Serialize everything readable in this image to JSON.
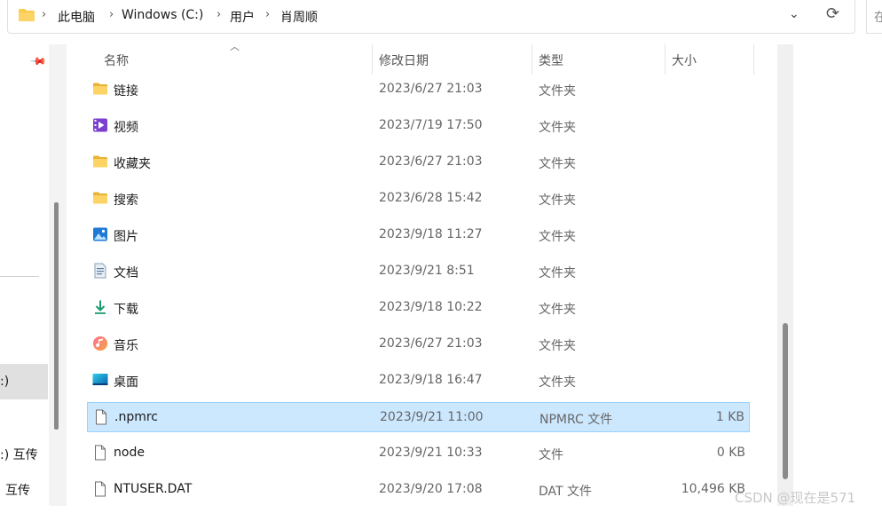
{
  "address_bar": {
    "crumbs": [
      "此电脑",
      "Windows (C:)",
      "用户",
      "肖周顺"
    ],
    "separator": "›",
    "dropdown_glyph": "⌄",
    "refresh_glyph": "⟳"
  },
  "search": {
    "text": "在"
  },
  "nav_pane": {
    "items": [
      ":)",
      ":) 互传",
      "互传"
    ]
  },
  "columns": {
    "name": "名称",
    "modified": "修改日期",
    "type": "类型",
    "size": "大小"
  },
  "files": [
    {
      "name": "链接",
      "modified": "2023/6/27 21:03",
      "type": "文件夹",
      "size": "",
      "icon": "folder-icon"
    },
    {
      "name": "视频",
      "modified": "2023/7/19 17:50",
      "type": "文件夹",
      "size": "",
      "icon": "videos-folder-icon"
    },
    {
      "name": "收藏夹",
      "modified": "2023/6/27 21:03",
      "type": "文件夹",
      "size": "",
      "icon": "folder-icon"
    },
    {
      "name": "搜索",
      "modified": "2023/6/28 15:42",
      "type": "文件夹",
      "size": "",
      "icon": "folder-icon"
    },
    {
      "name": "图片",
      "modified": "2023/9/18 11:27",
      "type": "文件夹",
      "size": "",
      "icon": "pictures-folder-icon"
    },
    {
      "name": "文档",
      "modified": "2023/9/21 8:51",
      "type": "文件夹",
      "size": "",
      "icon": "documents-folder-icon"
    },
    {
      "name": "下载",
      "modified": "2023/9/18 10:22",
      "type": "文件夹",
      "size": "",
      "icon": "downloads-folder-icon"
    },
    {
      "name": "音乐",
      "modified": "2023/6/27 21:03",
      "type": "文件夹",
      "size": "",
      "icon": "music-folder-icon"
    },
    {
      "name": "桌面",
      "modified": "2023/9/18 16:47",
      "type": "文件夹",
      "size": "",
      "icon": "desktop-folder-icon"
    },
    {
      "name": ".npmrc",
      "modified": "2023/9/21 11:00",
      "type": "NPMRC 文件",
      "size": "1 KB",
      "icon": "file-icon",
      "selected": true
    },
    {
      "name": "node",
      "modified": "2023/9/21 10:33",
      "type": "文件",
      "size": "0 KB",
      "icon": "file-icon"
    },
    {
      "name": "NTUSER.DAT",
      "modified": "2023/9/20 17:08",
      "type": "DAT 文件",
      "size": "10,496 KB",
      "icon": "file-icon"
    }
  ],
  "watermark": "CSDN @现在是571",
  "colors": {
    "selection": "#cce8ff",
    "selection_border": "#99d1ff",
    "folder": "#f8c94a"
  }
}
